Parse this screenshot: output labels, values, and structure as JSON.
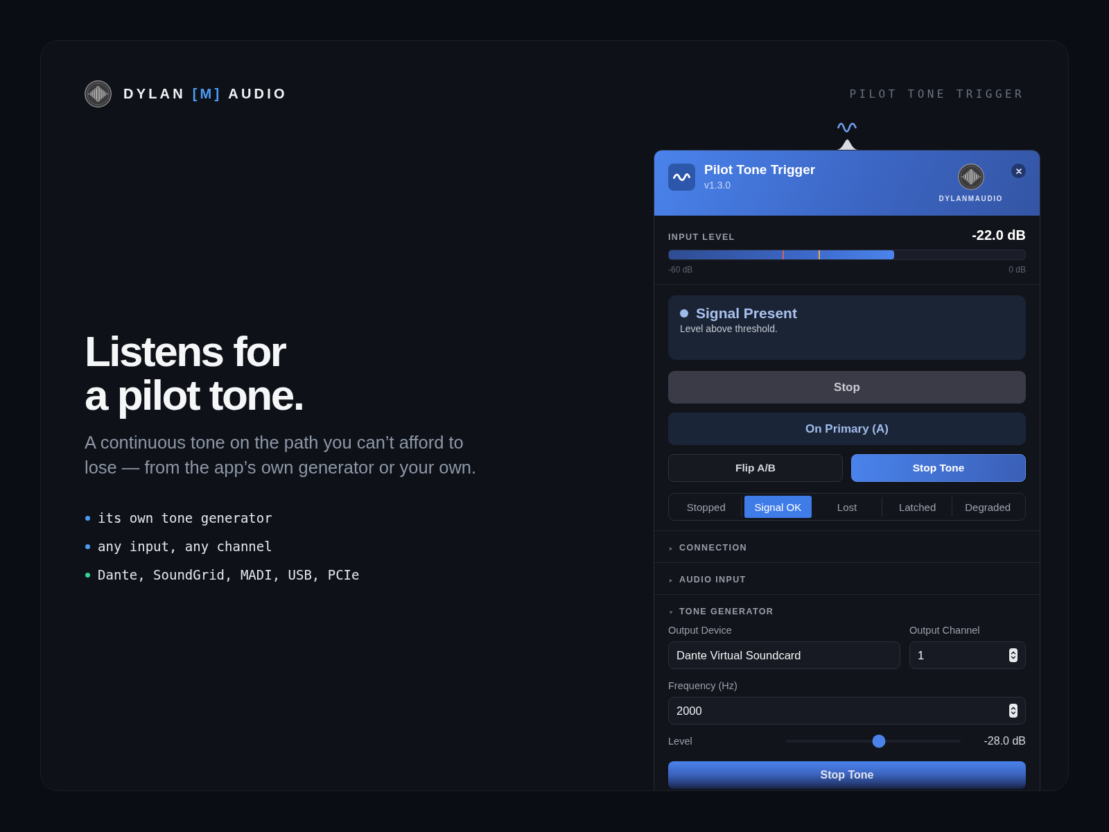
{
  "header": {
    "brand": {
      "name": "DYLAN",
      "mark": "[M]",
      "suffix": "AUDIO"
    },
    "tagline": "PILOT TONE TRIGGER"
  },
  "hero": {
    "headline": [
      "Listens for",
      "a pilot tone."
    ],
    "subtitle": "A continuous tone on the path you can’t afford to lose — from the app’s own generator or your own.",
    "features": [
      {
        "text": "its own tone generator",
        "color": "#4c9bf2"
      },
      {
        "text": "any input, any channel",
        "color": "#4c9bf2"
      },
      {
        "text": "Dante, SoundGrid, MADI, USB, PCIe",
        "color": "#34d399"
      }
    ]
  },
  "panel": {
    "title": "Pilot Tone Trigger",
    "version": "v1.3.0",
    "vendor": "DYLANMAUDIO",
    "input_level": {
      "label": "INPUT LEVEL",
      "reading": "-22.0 dB",
      "level": 0.633,
      "markers": [
        {
          "level": 0.32,
          "color": "#d9625a"
        },
        {
          "level": 0.42,
          "color": "#e8a94a"
        }
      ],
      "scale_min": "-60 dB",
      "scale_max": "0 dB"
    },
    "status": {
      "kind": "present",
      "title": "Signal Present",
      "detail": "Level above threshold."
    },
    "actions": [
      {
        "label": "Stop",
        "kind": "neutral"
      },
      {
        "label": "On Primary (A)",
        "kind": "route"
      }
    ],
    "pair": [
      {
        "label": "Flip A/B",
        "kind": "outline"
      },
      {
        "label": "Stop Tone",
        "kind": "primary"
      }
    ],
    "modes": [
      {
        "label": "Stopped",
        "selected": false
      },
      {
        "label": "Signal OK",
        "selected": true
      },
      {
        "label": "Lost",
        "selected": false
      },
      {
        "label": "Latched",
        "selected": false
      },
      {
        "label": "Degraded",
        "selected": false
      }
    ],
    "sections": [
      {
        "title": "CONNECTION",
        "expanded": false
      },
      {
        "title": "AUDIO INPUT",
        "expanded": false
      },
      {
        "title": "TONE GENERATOR",
        "expanded": true,
        "body": {
          "output_device": {
            "label": "Output Device",
            "value": "Dante Virtual Soundcard"
          },
          "output_channel": {
            "label": "Output Channel",
            "value": "1"
          },
          "frequency": {
            "label": "Frequency (Hz)",
            "value": "2000"
          },
          "level": {
            "label": "Level",
            "level": 0.53,
            "reading": "-28.0 dB"
          },
          "button": "Stop Tone"
        }
      }
    ]
  }
}
